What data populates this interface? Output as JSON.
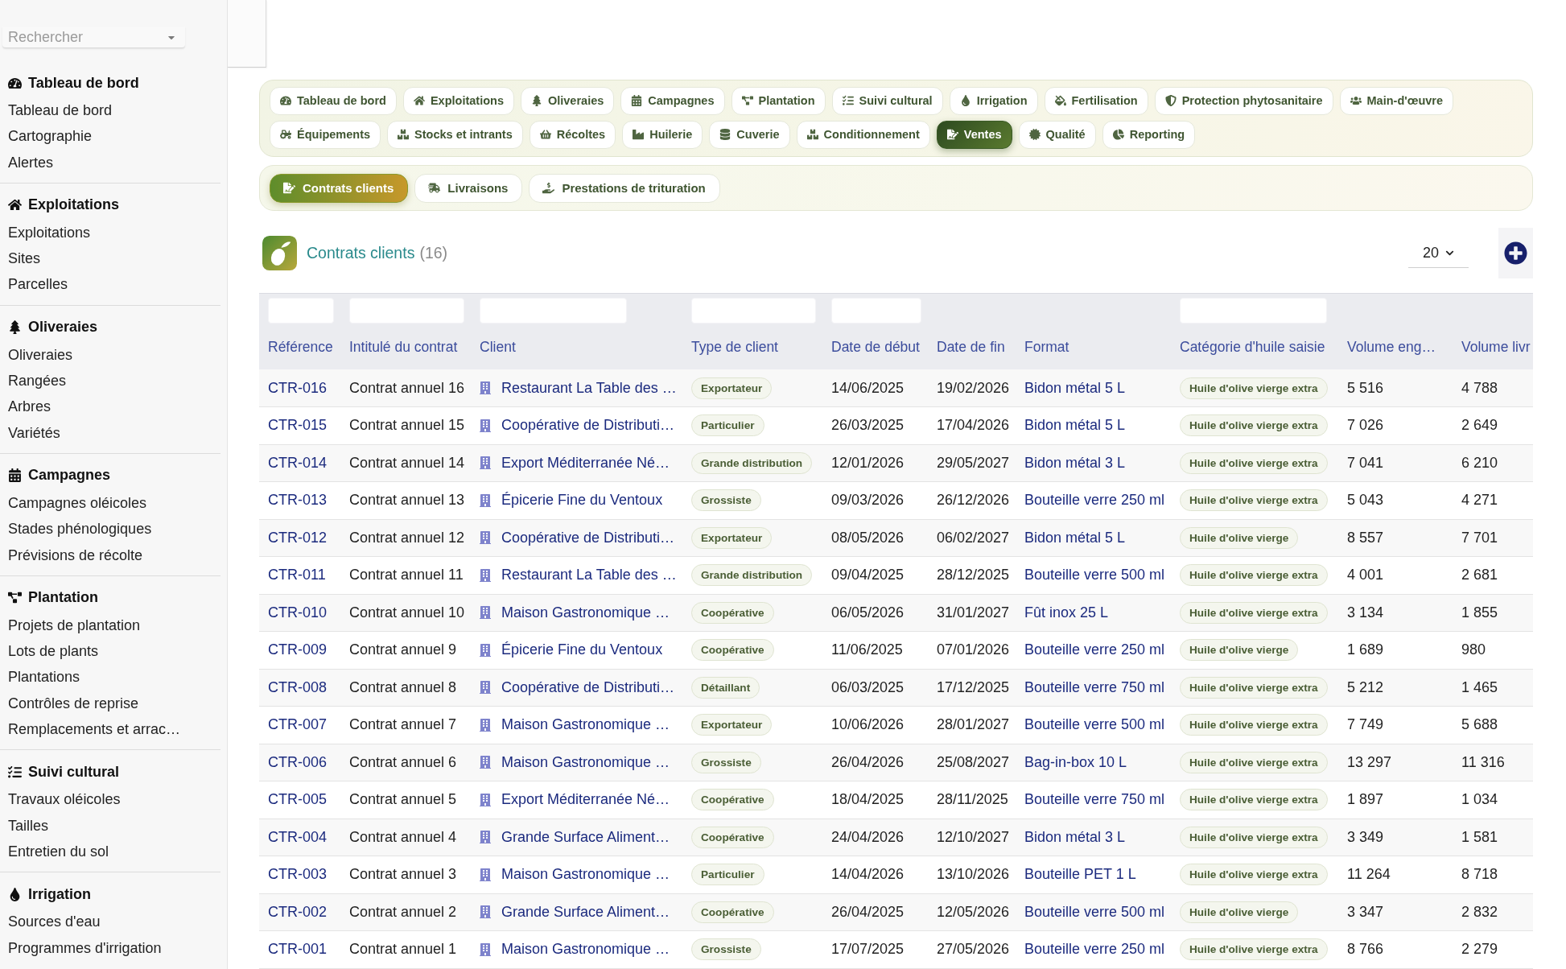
{
  "sidebar": {
    "search": {
      "placeholder": "Rechercher"
    },
    "sections": [
      {
        "title": "Tableau de bord",
        "items": [
          "Tableau de bord",
          "Cartographie",
          "Alertes"
        ]
      },
      {
        "title": "Exploitations",
        "items": [
          "Exploitations",
          "Sites",
          "Parcelles"
        ]
      },
      {
        "title": "Oliveraies",
        "items": [
          "Oliveraies",
          "Rangées",
          "Arbres",
          "Variétés"
        ]
      },
      {
        "title": "Campagnes",
        "items": [
          "Campagnes oléicoles",
          "Stades phénologiques",
          "Prévisions de récolte"
        ]
      },
      {
        "title": "Plantation",
        "items": [
          "Projets de plantation",
          "Lots de plants",
          "Plantations",
          "Contrôles de reprise",
          "Remplacements et arrac…"
        ]
      },
      {
        "title": "Suivi cultural",
        "items": [
          "Travaux oléicoles",
          "Tailles",
          "Entretien du sol"
        ]
      },
      {
        "title": "Irrigation",
        "items": [
          "Sources d'eau",
          "Programmes d'irrigation"
        ]
      }
    ]
  },
  "module_tabs": [
    {
      "label": "Tableau de bord",
      "selected": false
    },
    {
      "label": "Exploitations",
      "selected": false
    },
    {
      "label": "Oliveraies",
      "selected": false
    },
    {
      "label": "Campagnes",
      "selected": false
    },
    {
      "label": "Plantation",
      "selected": false
    },
    {
      "label": "Suivi cultural",
      "selected": false
    },
    {
      "label": "Irrigation",
      "selected": false
    },
    {
      "label": "Fertilisation",
      "selected": false
    },
    {
      "label": "Protection phytosanitaire",
      "selected": false
    },
    {
      "label": "Main-d'œuvre",
      "selected": false
    },
    {
      "label": "Équipements",
      "selected": false
    },
    {
      "label": "Stocks et intrants",
      "selected": false
    },
    {
      "label": "Récoltes",
      "selected": false
    },
    {
      "label": "Huilerie",
      "selected": false
    },
    {
      "label": "Cuverie",
      "selected": false
    },
    {
      "label": "Conditionnement",
      "selected": false
    },
    {
      "label": "Ventes",
      "selected": true
    },
    {
      "label": "Qualité",
      "selected": false
    },
    {
      "label": "Reporting",
      "selected": false
    }
  ],
  "sub_tabs": [
    {
      "label": "Contrats clients",
      "selected": true
    },
    {
      "label": "Livraisons",
      "selected": false
    },
    {
      "label": "Prestations de trituration",
      "selected": false
    }
  ],
  "list_header": {
    "title": "Contrats clients",
    "count": "(16)",
    "page_size": "20"
  },
  "table": {
    "columns": [
      {
        "label": "Référence",
        "kind": "link",
        "filter": true
      },
      {
        "label": "Intitulé du contrat",
        "kind": "text",
        "filter": true
      },
      {
        "label": "Client",
        "kind": "client",
        "filter": true
      },
      {
        "label": "Type de client",
        "kind": "badge",
        "filter": true
      },
      {
        "label": "Date de début",
        "kind": "text",
        "filter": true
      },
      {
        "label": "Date de fin",
        "kind": "text",
        "filter": false
      },
      {
        "label": "Format",
        "kind": "link",
        "filter": false
      },
      {
        "label": "Catégorie d'huile saisie",
        "kind": "badge",
        "filter": true
      },
      {
        "label": "Volume eng…",
        "kind": "text",
        "filter": false
      },
      {
        "label": "Volume livr",
        "kind": "text",
        "filter": false
      }
    ],
    "rows": [
      [
        "CTR-016",
        "Contrat annuel 16",
        "Restaurant La Table des …",
        "Exportateur",
        "14/06/2025",
        "19/02/2026",
        "Bidon métal 5 L",
        "Huile d'olive vierge extra",
        "5 516",
        "4 788"
      ],
      [
        "CTR-015",
        "Contrat annuel 15",
        "Coopérative de Distributi…",
        "Particulier",
        "26/03/2025",
        "17/04/2026",
        "Bidon métal 5 L",
        "Huile d'olive vierge extra",
        "7 026",
        "2 649"
      ],
      [
        "CTR-014",
        "Contrat annuel 14",
        "Export Méditerranée Né…",
        "Grande distribution",
        "12/01/2026",
        "29/05/2027",
        "Bidon métal 3 L",
        "Huile d'olive vierge extra",
        "7 041",
        "6 210"
      ],
      [
        "CTR-013",
        "Contrat annuel 13",
        "Épicerie Fine du Ventoux",
        "Grossiste",
        "09/03/2026",
        "26/12/2026",
        "Bouteille verre 250 ml",
        "Huile d'olive vierge extra",
        "5 043",
        "4 271"
      ],
      [
        "CTR-012",
        "Contrat annuel 12",
        "Coopérative de Distributi…",
        "Exportateur",
        "08/05/2026",
        "06/02/2027",
        "Bidon métal 5 L",
        "Huile d'olive vierge",
        "8 557",
        "7 701"
      ],
      [
        "CTR-011",
        "Contrat annuel 11",
        "Restaurant La Table des …",
        "Grande distribution",
        "09/04/2025",
        "28/12/2025",
        "Bouteille verre 500 ml",
        "Huile d'olive vierge extra",
        "4 001",
        "2 681"
      ],
      [
        "CTR-010",
        "Contrat annuel 10",
        "Maison Gastronomique …",
        "Coopérative",
        "06/05/2026",
        "31/01/2027",
        "Fût inox 25 L",
        "Huile d'olive vierge extra",
        "3 134",
        "1 855"
      ],
      [
        "CTR-009",
        "Contrat annuel 9",
        "Épicerie Fine du Ventoux",
        "Coopérative",
        "11/06/2025",
        "07/01/2026",
        "Bouteille verre 250 ml",
        "Huile d'olive vierge",
        "1 689",
        "980"
      ],
      [
        "CTR-008",
        "Contrat annuel 8",
        "Coopérative de Distributi…",
        "Détaillant",
        "06/03/2025",
        "17/12/2025",
        "Bouteille verre 750 ml",
        "Huile d'olive vierge extra",
        "5 212",
        "1 465"
      ],
      [
        "CTR-007",
        "Contrat annuel 7",
        "Maison Gastronomique …",
        "Exportateur",
        "10/06/2026",
        "28/01/2027",
        "Bouteille verre 500 ml",
        "Huile d'olive vierge extra",
        "7 749",
        "5 688"
      ],
      [
        "CTR-006",
        "Contrat annuel 6",
        "Maison Gastronomique …",
        "Grossiste",
        "26/04/2026",
        "25/08/2027",
        "Bag-in-box 10 L",
        "Huile d'olive vierge extra",
        "13 297",
        "11 316"
      ],
      [
        "CTR-005",
        "Contrat annuel 5",
        "Export Méditerranée Né…",
        "Coopérative",
        "18/04/2025",
        "28/11/2025",
        "Bouteille verre 750 ml",
        "Huile d'olive vierge extra",
        "1 897",
        "1 034"
      ],
      [
        "CTR-004",
        "Contrat annuel 4",
        "Grande Surface Aliment…",
        "Coopérative",
        "24/04/2026",
        "12/10/2027",
        "Bidon métal 3 L",
        "Huile d'olive vierge extra",
        "3 349",
        "1 581"
      ],
      [
        "CTR-003",
        "Contrat annuel 3",
        "Maison Gastronomique …",
        "Particulier",
        "14/04/2026",
        "13/10/2026",
        "Bouteille PET 1 L",
        "Huile d'olive vierge extra",
        "11 264",
        "8 718"
      ],
      [
        "CTR-002",
        "Contrat annuel 2",
        "Grande Surface Aliment…",
        "Coopérative",
        "26/04/2025",
        "12/05/2026",
        "Bouteille verre 500 ml",
        "Huile d'olive vierge",
        "3 347",
        "2 832"
      ],
      [
        "CTR-001",
        "Contrat annuel 1",
        "Maison Gastronomique …",
        "Grossiste",
        "17/07/2025",
        "27/05/2026",
        "Bouteille verre 250 ml",
        "Huile d'olive vierge extra",
        "8 766",
        "2 279"
      ]
    ]
  }
}
